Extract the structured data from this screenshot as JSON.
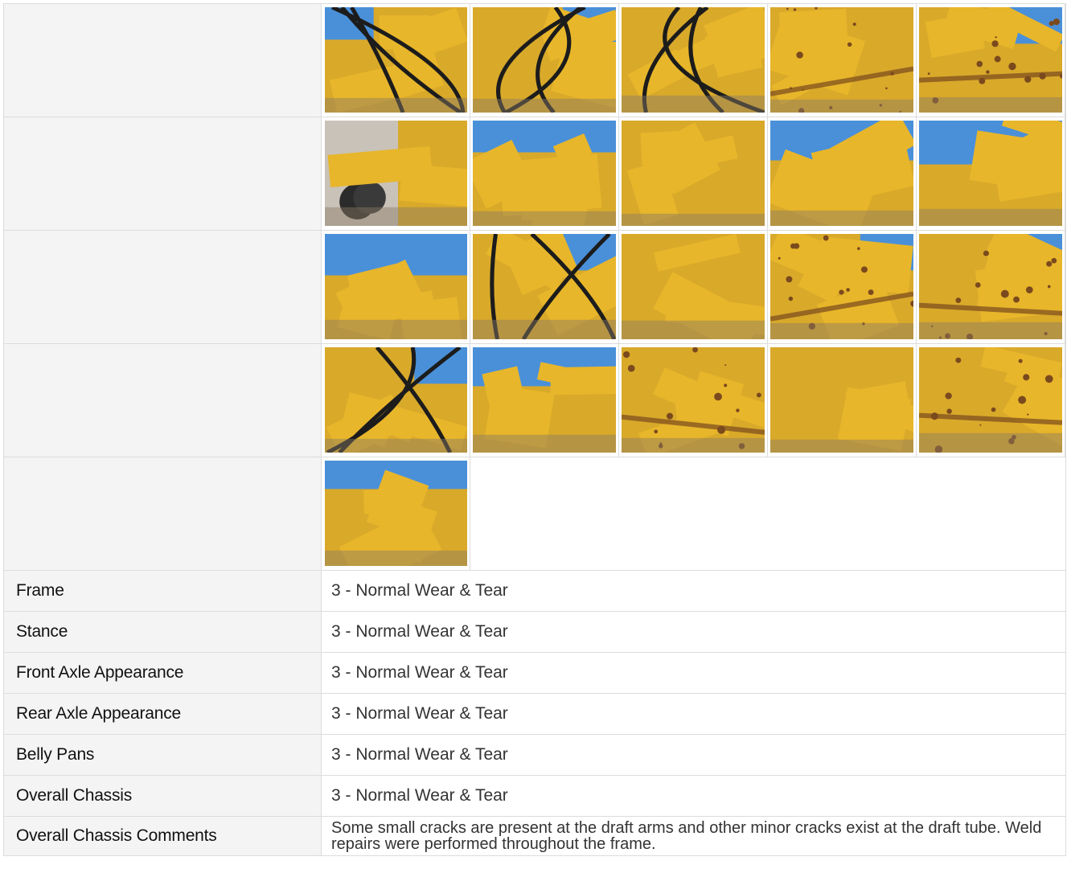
{
  "photo_grid": {
    "rows": [
      {
        "photos": [
          {
            "name": "photo-lift-arm-hydraulics",
            "palette": "sky-left"
          },
          {
            "name": "photo-pivot-joint",
            "palette": "sky-right"
          },
          {
            "name": "photo-hoses-bracket",
            "palette": "dark"
          },
          {
            "name": "photo-rusty-weld-closeup",
            "palette": "rust"
          },
          {
            "name": "photo-weld-joint-closeup",
            "palette": "rust-sky"
          }
        ]
      },
      {
        "photos": [
          {
            "name": "photo-frame-side-tires",
            "palette": "wall"
          },
          {
            "name": "photo-tube-underside",
            "palette": "sky-top"
          },
          {
            "name": "photo-frame-crack-weld",
            "palette": "flat"
          },
          {
            "name": "photo-draft-arm-lot",
            "palette": "sky-top"
          },
          {
            "name": "photo-draft-tube-truck",
            "palette": "sky-top"
          }
        ]
      },
      {
        "photos": [
          {
            "name": "photo-draft-tube-side",
            "palette": "sky-top"
          },
          {
            "name": "photo-moldboard-front",
            "palette": "sky-right"
          },
          {
            "name": "photo-frame-panel",
            "palette": "flat"
          },
          {
            "name": "photo-frame-crack-rust",
            "palette": "rust-sky"
          },
          {
            "name": "photo-frame-weld-seam",
            "palette": "rust-sky"
          }
        ]
      },
      {
        "photos": [
          {
            "name": "photo-circle-pivot",
            "palette": "sky-right"
          },
          {
            "name": "photo-cat-3-draft-frame",
            "palette": "sky-top"
          },
          {
            "name": "photo-rusty-edge",
            "palette": "rust"
          },
          {
            "name": "photo-slot-detail",
            "palette": "flat"
          },
          {
            "name": "photo-weld-seam-rust",
            "palette": "rust"
          }
        ]
      },
      {
        "photos": [
          {
            "name": "photo-cat-3-frame-side",
            "palette": "sky-top"
          }
        ]
      }
    ]
  },
  "attributes": [
    {
      "label": "Frame",
      "value": "3 - Normal Wear & Tear"
    },
    {
      "label": "Stance",
      "value": "3 - Normal Wear & Tear"
    },
    {
      "label": "Front Axle Appearance",
      "value": "3 - Normal Wear & Tear"
    },
    {
      "label": "Rear Axle Appearance",
      "value": "3 - Normal Wear & Tear"
    },
    {
      "label": "Belly Pans",
      "value": "3 - Normal Wear & Tear"
    },
    {
      "label": "Overall Chassis",
      "value": "3 - Normal Wear & Tear"
    }
  ],
  "comments": {
    "label": "Overall Chassis Comments",
    "value": "Some small cracks are present at the draft arms and other minor cracks exist at the draft tube. Weld repairs were performed throughout the frame."
  },
  "colors": {
    "machine_yellow": "#e8b62a",
    "sky_blue": "#4a90d9",
    "rust": "#7a4a1e",
    "label_bg": "#f4f4f4",
    "border": "#dcdcdc"
  }
}
